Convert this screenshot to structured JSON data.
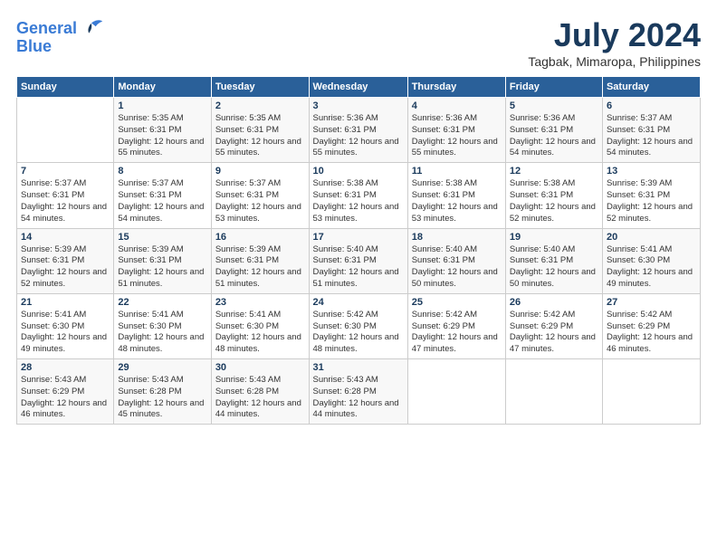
{
  "logo": {
    "line1": "General",
    "line2": "Blue"
  },
  "title": "July 2024",
  "location": "Tagbak, Mimaropa, Philippines",
  "weekdays": [
    "Sunday",
    "Monday",
    "Tuesday",
    "Wednesday",
    "Thursday",
    "Friday",
    "Saturday"
  ],
  "weeks": [
    [
      {
        "day": "",
        "sunrise": "",
        "sunset": "",
        "daylight": ""
      },
      {
        "day": "1",
        "sunrise": "Sunrise: 5:35 AM",
        "sunset": "Sunset: 6:31 PM",
        "daylight": "Daylight: 12 hours and 55 minutes."
      },
      {
        "day": "2",
        "sunrise": "Sunrise: 5:35 AM",
        "sunset": "Sunset: 6:31 PM",
        "daylight": "Daylight: 12 hours and 55 minutes."
      },
      {
        "day": "3",
        "sunrise": "Sunrise: 5:36 AM",
        "sunset": "Sunset: 6:31 PM",
        "daylight": "Daylight: 12 hours and 55 minutes."
      },
      {
        "day": "4",
        "sunrise": "Sunrise: 5:36 AM",
        "sunset": "Sunset: 6:31 PM",
        "daylight": "Daylight: 12 hours and 55 minutes."
      },
      {
        "day": "5",
        "sunrise": "Sunrise: 5:36 AM",
        "sunset": "Sunset: 6:31 PM",
        "daylight": "Daylight: 12 hours and 54 minutes."
      },
      {
        "day": "6",
        "sunrise": "Sunrise: 5:37 AM",
        "sunset": "Sunset: 6:31 PM",
        "daylight": "Daylight: 12 hours and 54 minutes."
      }
    ],
    [
      {
        "day": "7",
        "sunrise": "Sunrise: 5:37 AM",
        "sunset": "Sunset: 6:31 PM",
        "daylight": "Daylight: 12 hours and 54 minutes."
      },
      {
        "day": "8",
        "sunrise": "Sunrise: 5:37 AM",
        "sunset": "Sunset: 6:31 PM",
        "daylight": "Daylight: 12 hours and 54 minutes."
      },
      {
        "day": "9",
        "sunrise": "Sunrise: 5:37 AM",
        "sunset": "Sunset: 6:31 PM",
        "daylight": "Daylight: 12 hours and 53 minutes."
      },
      {
        "day": "10",
        "sunrise": "Sunrise: 5:38 AM",
        "sunset": "Sunset: 6:31 PM",
        "daylight": "Daylight: 12 hours and 53 minutes."
      },
      {
        "day": "11",
        "sunrise": "Sunrise: 5:38 AM",
        "sunset": "Sunset: 6:31 PM",
        "daylight": "Daylight: 12 hours and 53 minutes."
      },
      {
        "day": "12",
        "sunrise": "Sunrise: 5:38 AM",
        "sunset": "Sunset: 6:31 PM",
        "daylight": "Daylight: 12 hours and 52 minutes."
      },
      {
        "day": "13",
        "sunrise": "Sunrise: 5:39 AM",
        "sunset": "Sunset: 6:31 PM",
        "daylight": "Daylight: 12 hours and 52 minutes."
      }
    ],
    [
      {
        "day": "14",
        "sunrise": "Sunrise: 5:39 AM",
        "sunset": "Sunset: 6:31 PM",
        "daylight": "Daylight: 12 hours and 52 minutes."
      },
      {
        "day": "15",
        "sunrise": "Sunrise: 5:39 AM",
        "sunset": "Sunset: 6:31 PM",
        "daylight": "Daylight: 12 hours and 51 minutes."
      },
      {
        "day": "16",
        "sunrise": "Sunrise: 5:39 AM",
        "sunset": "Sunset: 6:31 PM",
        "daylight": "Daylight: 12 hours and 51 minutes."
      },
      {
        "day": "17",
        "sunrise": "Sunrise: 5:40 AM",
        "sunset": "Sunset: 6:31 PM",
        "daylight": "Daylight: 12 hours and 51 minutes."
      },
      {
        "day": "18",
        "sunrise": "Sunrise: 5:40 AM",
        "sunset": "Sunset: 6:31 PM",
        "daylight": "Daylight: 12 hours and 50 minutes."
      },
      {
        "day": "19",
        "sunrise": "Sunrise: 5:40 AM",
        "sunset": "Sunset: 6:31 PM",
        "daylight": "Daylight: 12 hours and 50 minutes."
      },
      {
        "day": "20",
        "sunrise": "Sunrise: 5:41 AM",
        "sunset": "Sunset: 6:30 PM",
        "daylight": "Daylight: 12 hours and 49 minutes."
      }
    ],
    [
      {
        "day": "21",
        "sunrise": "Sunrise: 5:41 AM",
        "sunset": "Sunset: 6:30 PM",
        "daylight": "Daylight: 12 hours and 49 minutes."
      },
      {
        "day": "22",
        "sunrise": "Sunrise: 5:41 AM",
        "sunset": "Sunset: 6:30 PM",
        "daylight": "Daylight: 12 hours and 48 minutes."
      },
      {
        "day": "23",
        "sunrise": "Sunrise: 5:41 AM",
        "sunset": "Sunset: 6:30 PM",
        "daylight": "Daylight: 12 hours and 48 minutes."
      },
      {
        "day": "24",
        "sunrise": "Sunrise: 5:42 AM",
        "sunset": "Sunset: 6:30 PM",
        "daylight": "Daylight: 12 hours and 48 minutes."
      },
      {
        "day": "25",
        "sunrise": "Sunrise: 5:42 AM",
        "sunset": "Sunset: 6:29 PM",
        "daylight": "Daylight: 12 hours and 47 minutes."
      },
      {
        "day": "26",
        "sunrise": "Sunrise: 5:42 AM",
        "sunset": "Sunset: 6:29 PM",
        "daylight": "Daylight: 12 hours and 47 minutes."
      },
      {
        "day": "27",
        "sunrise": "Sunrise: 5:42 AM",
        "sunset": "Sunset: 6:29 PM",
        "daylight": "Daylight: 12 hours and 46 minutes."
      }
    ],
    [
      {
        "day": "28",
        "sunrise": "Sunrise: 5:43 AM",
        "sunset": "Sunset: 6:29 PM",
        "daylight": "Daylight: 12 hours and 46 minutes."
      },
      {
        "day": "29",
        "sunrise": "Sunrise: 5:43 AM",
        "sunset": "Sunset: 6:28 PM",
        "daylight": "Daylight: 12 hours and 45 minutes."
      },
      {
        "day": "30",
        "sunrise": "Sunrise: 5:43 AM",
        "sunset": "Sunset: 6:28 PM",
        "daylight": "Daylight: 12 hours and 44 minutes."
      },
      {
        "day": "31",
        "sunrise": "Sunrise: 5:43 AM",
        "sunset": "Sunset: 6:28 PM",
        "daylight": "Daylight: 12 hours and 44 minutes."
      },
      {
        "day": "",
        "sunrise": "",
        "sunset": "",
        "daylight": ""
      },
      {
        "day": "",
        "sunrise": "",
        "sunset": "",
        "daylight": ""
      },
      {
        "day": "",
        "sunrise": "",
        "sunset": "",
        "daylight": ""
      }
    ]
  ]
}
